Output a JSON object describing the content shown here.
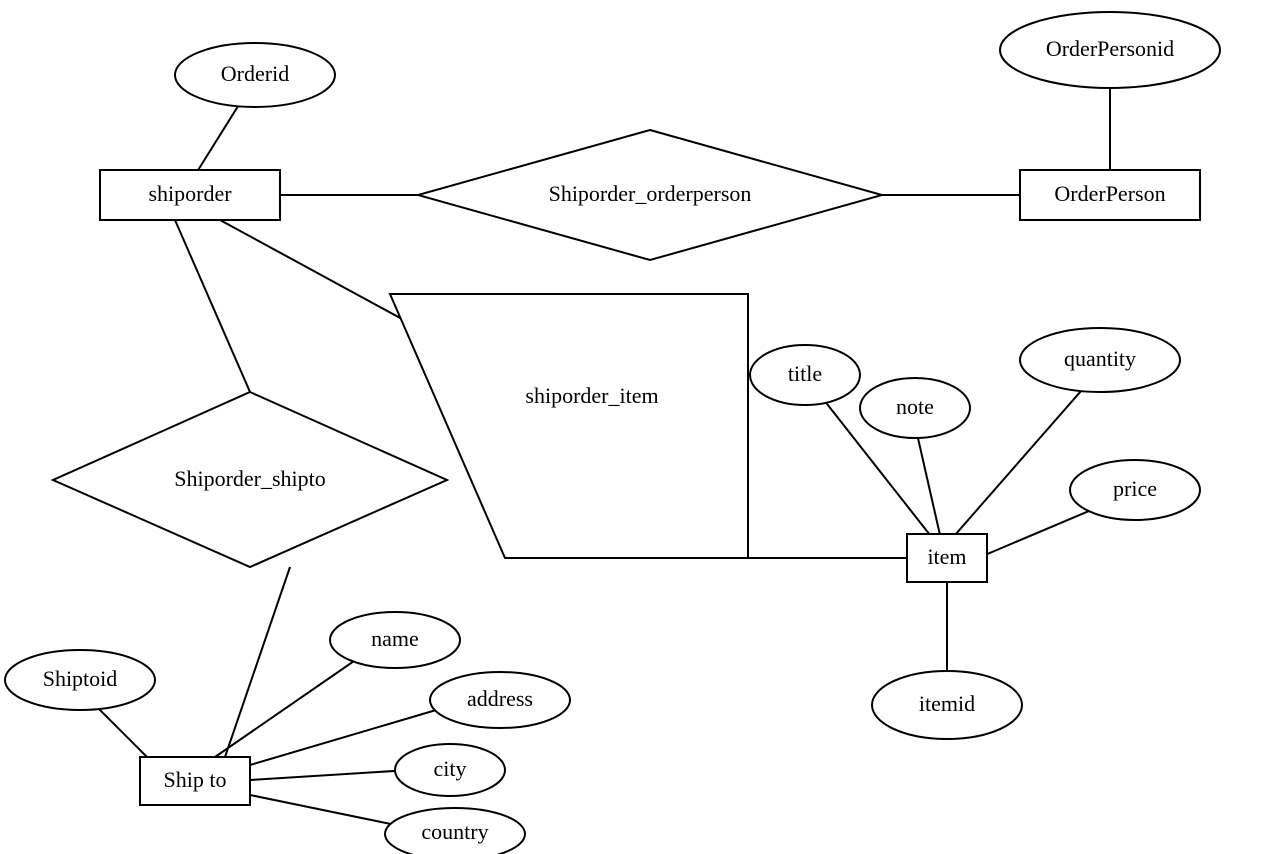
{
  "entities": {
    "shiporder": {
      "label": "shiporder",
      "attributes": {
        "orderid": "Orderid"
      }
    },
    "orderperson": {
      "label": "OrderPerson",
      "attributes": {
        "orderpersonid": "OrderPersonid"
      }
    },
    "item": {
      "label": "item",
      "attributes": {
        "title": "title",
        "note": "note",
        "quantity": "quantity",
        "price": "price",
        "itemid": "itemid"
      }
    },
    "shipto": {
      "label": "Ship to",
      "attributes": {
        "shiptoid": "Shiptoid",
        "name": "name",
        "address": "address",
        "city": "city",
        "country": "country"
      }
    }
  },
  "relationships": {
    "shiporder_orderperson": {
      "label": "Shiporder_orderperson"
    },
    "shiporder_item": {
      "label": "shiporder_item"
    },
    "shiporder_shipto": {
      "label": "Shiporder_shipto"
    }
  }
}
